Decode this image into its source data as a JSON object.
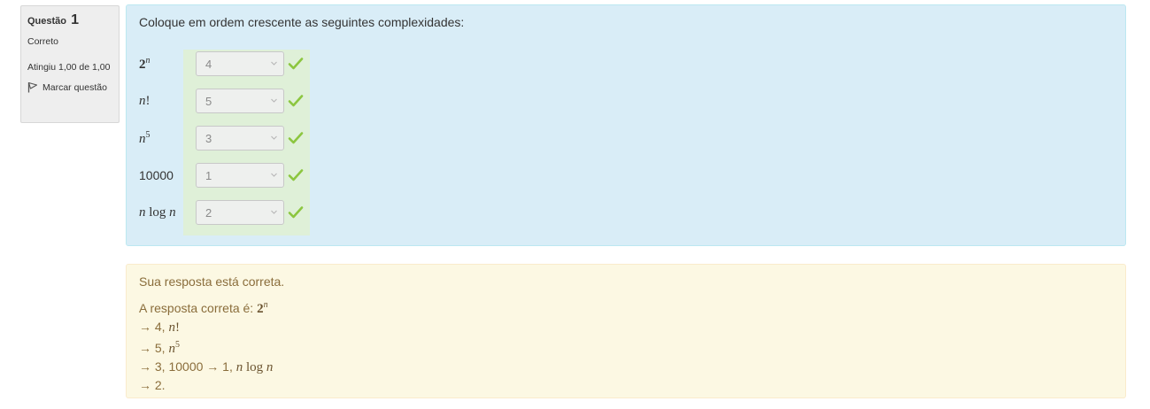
{
  "info": {
    "question_label": "Questão",
    "question_number": "1",
    "state": "Correto",
    "grade": "Atingiu 1,00 de 1,00",
    "flag_label": "Marcar questão"
  },
  "question": {
    "text": "Coloque em ordem crescente as seguintes complexidades:",
    "rows": [
      {
        "stem": "2^n",
        "selected": "4",
        "status": "correct"
      },
      {
        "stem": "n!",
        "selected": "5",
        "status": "correct"
      },
      {
        "stem": "n^5",
        "selected": "3",
        "status": "correct"
      },
      {
        "stem": "10000",
        "selected": "1",
        "status": "correct"
      },
      {
        "stem": "n log n",
        "selected": "2",
        "status": "correct"
      }
    ]
  },
  "feedback": {
    "result": "Sua resposta está correta.",
    "answer_prefix": "A resposta correta é:",
    "answer_lines": [
      {
        "arrow": "→",
        "text": "4,"
      },
      {
        "arrow": "→",
        "text": "5,"
      },
      {
        "arrow": "→",
        "text": "3, 10000 → 1,"
      },
      {
        "arrow": "→",
        "text": "2."
      }
    ]
  },
  "colors": {
    "question_bg": "#d9edf7",
    "correct_bg": "#dff0d8",
    "feedback_bg": "#fcf8e3",
    "tick": "#8cc63f"
  }
}
